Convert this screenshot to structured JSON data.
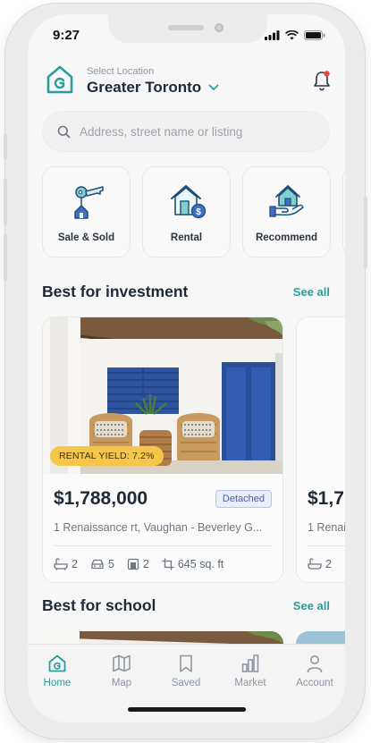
{
  "status_bar": {
    "time": "9:27"
  },
  "header": {
    "location_label": "Select Location",
    "location_name": "Greater Toronto"
  },
  "search": {
    "placeholder": "Address, street name or listing"
  },
  "categories": [
    {
      "label": "Sale & Sold",
      "icon": "keys-house-icon"
    },
    {
      "label": "Rental",
      "icon": "house-dollar-icon"
    },
    {
      "label": "Recommend",
      "icon": "hand-house-icon"
    }
  ],
  "sections": {
    "investment": {
      "title": "Best for investment",
      "see_all": "See all"
    },
    "school": {
      "title": "Best for school",
      "see_all": "See all"
    }
  },
  "listings": [
    {
      "yield_badge": "RENTAL YIELD: 7.2%",
      "price": "$1,788,000",
      "type": "Detached",
      "address": "1 Renaissance rt, Vaughan - Beverley G...",
      "beds": "2",
      "parking": "5",
      "baths": "2",
      "area": "645 sq. ft"
    },
    {
      "price": "$1,7",
      "address": "1 Renai",
      "beds": "2"
    }
  ],
  "tabbar": [
    {
      "label": "Home",
      "icon": "home-icon",
      "active": true
    },
    {
      "label": "Map",
      "icon": "map-icon",
      "active": false
    },
    {
      "label": "Saved",
      "icon": "bookmark-icon",
      "active": false
    },
    {
      "label": "Market",
      "icon": "bar-chart-icon",
      "active": false
    },
    {
      "label": "Account",
      "icon": "person-icon",
      "active": false
    }
  ],
  "colors": {
    "accent": "#2a9d9c",
    "badge_yellow": "#f6c64a",
    "notification_dot": "#e8453c"
  }
}
